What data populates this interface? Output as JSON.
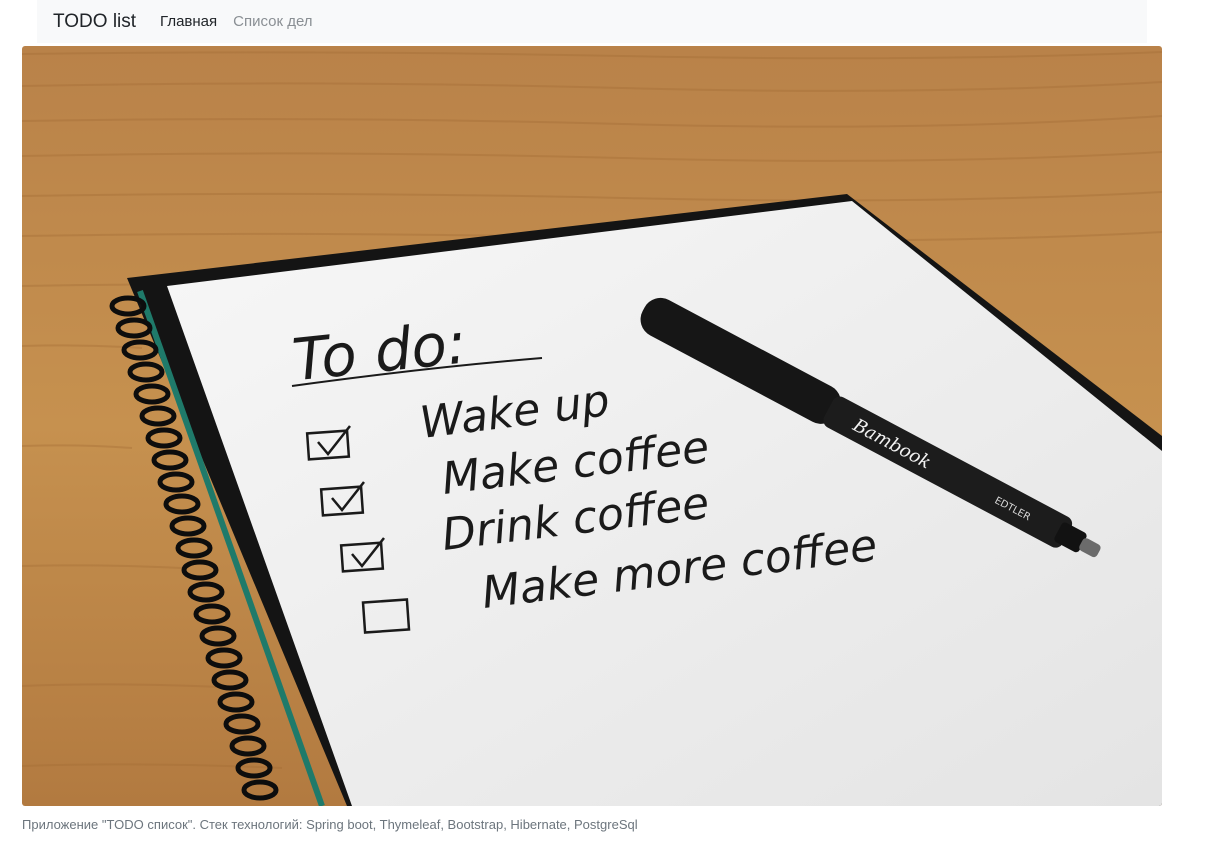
{
  "navbar": {
    "brand": "TODO list",
    "links": [
      {
        "label": "Главная",
        "active": true
      },
      {
        "label": "Список дел",
        "active": false
      }
    ]
  },
  "hero_image": {
    "heading": "To do:",
    "items": [
      {
        "text": "Wake up",
        "checked": true
      },
      {
        "text": "Make coffee",
        "checked": true
      },
      {
        "text": "Drink coffee",
        "checked": true
      },
      {
        "text": "Make more coffee",
        "checked": false
      }
    ],
    "pen_brand": "Bambook",
    "pen_side_text": "EDTLER"
  },
  "caption": "Приложение \"TODO список\". Стек технологий: Spring boot, Thymeleaf, Bootstrap, Hibernate, PostgreSql",
  "colors": {
    "navbar_bg": "#f8f9fa",
    "wood": "#c28a4e",
    "paper": "#f1f1f1",
    "ink": "#1a1a1a",
    "caption": "#6c757d"
  }
}
